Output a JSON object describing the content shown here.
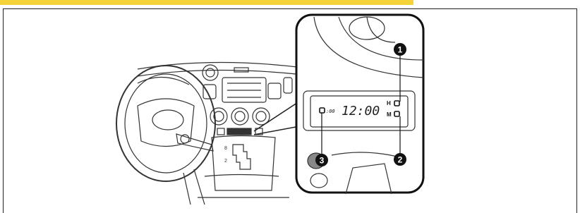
{
  "clock": {
    "time": "12:00",
    "small_label": ":00",
    "hour_label": "H",
    "minute_label": "M"
  },
  "callouts": [
    "1",
    "2",
    "3"
  ],
  "colors": {
    "accent_bar": "#f5d33a",
    "line": "#222222"
  }
}
